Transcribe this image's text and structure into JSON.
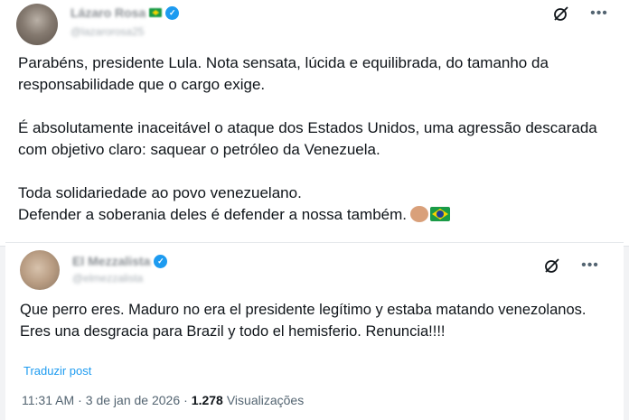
{
  "tweet1": {
    "author_name": "Lázaro Rosa",
    "author_handle": "@lazarorosa25",
    "paragraphs": [
      "Parabéns, presidente Lula. Nota sensata, lúcida e equilibrada, do tamanho da responsabilidade que o cargo exige.",
      "É absolutamente inaceitável o ataque dos Estados Unidos, uma agressão descarada com objetivo claro: saquear o petróleo da Venezuela.",
      "Toda solidariedade ao povo venezuelano."
    ],
    "last_line": "Defender a soberania deles é defender a nossa também.",
    "icons": [
      "grok-icon",
      "more-icon",
      "fist-emoji",
      "brazil-flag-emoji",
      "verified-badge-icon",
      "brazil-flag-icon"
    ]
  },
  "tweet2": {
    "author_name": "El Mezzalista",
    "author_handle": "@elmezzalista",
    "text": "Que perro eres. Maduro no era el presidente legítimo y estaba matando venezolanos.  Eres una desgracia para Brazil y todo el hemisferio. Renuncia!!!!",
    "translate_label": "Traduzir post",
    "time": "11:31 AM",
    "separator": "·",
    "date": "3 de jan de 2026",
    "views_count": "1.278",
    "views_label": "Visualizações",
    "icons": [
      "grok-icon",
      "more-icon",
      "verified-badge-icon"
    ]
  },
  "colors": {
    "link_blue": "#1d9bf0",
    "text": "#0f1419",
    "secondary_text": "#536471"
  }
}
